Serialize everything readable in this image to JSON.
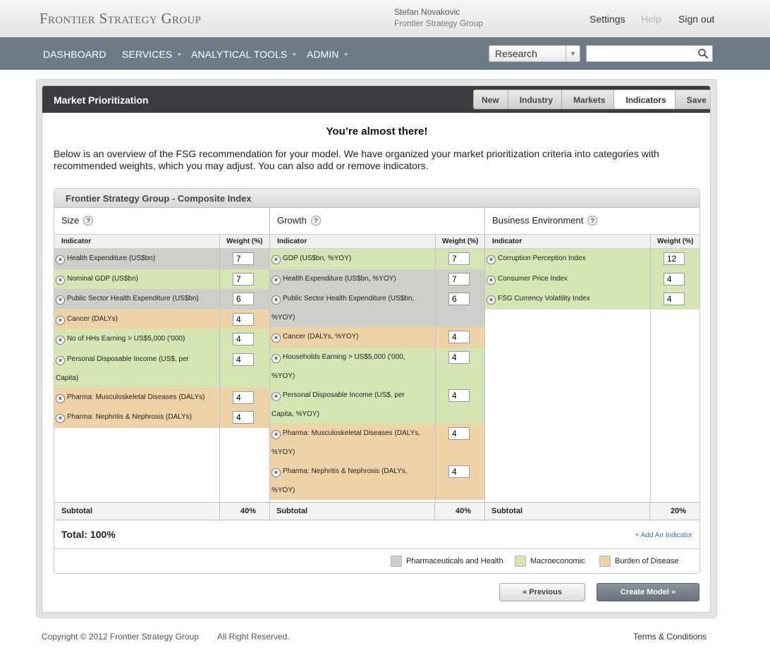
{
  "brand": {
    "logo": "Frontier Strategy Group"
  },
  "user": {
    "name": "Stefan Novakovic",
    "org": "Frontier Strategy Group"
  },
  "toplinks": {
    "settings": "Settings",
    "help": "Help",
    "signout": "Sign out"
  },
  "nav": {
    "dashboard": "DASHBOARD",
    "services": "SERVICES",
    "tools": "ANALYTICAL TOOLS",
    "admin": "ADMIN",
    "research_select": "Research",
    "search_placeholder": ""
  },
  "page": {
    "title": "Market Prioritization",
    "steps": [
      "New",
      "Industry",
      "Markets",
      "Indicators",
      "Save"
    ],
    "active_step": "Indicators",
    "heading": "You’re almost there!",
    "intro": "Below is an overview of the FSG recommendation for your model. We have organized your market prioritization criteria into categories with recommended weights, which you may adjust. You can also add or remove indicators."
  },
  "panel": {
    "title": "Frontier Strategy Group - Composite Index",
    "indicator_header": "Indicator",
    "weight_header": "Weight (%)",
    "subtotal_label": "Subtotal",
    "total": "Total: 100%",
    "add_indicator": "+ Add An Indicator",
    "columns": [
      {
        "title": "Size",
        "subtotal": "40%",
        "rows": [
          {
            "label": "Health Expenditure (US$bn)",
            "weight": "7",
            "category": "pharma"
          },
          {
            "label": "Nominal GDP (US$bn)",
            "weight": "7",
            "category": "macro"
          },
          {
            "label": "Public Sector Health Expenditure (US$bn)",
            "weight": "6",
            "category": "pharma"
          },
          {
            "label": "Cancer (DALYs)",
            "weight": "4",
            "category": "burden"
          },
          {
            "label": "No of HHs Earning > US$5,000 ('000)",
            "weight": "4",
            "category": "macro"
          },
          {
            "label": "Personal Disposable Income (US$, per",
            "label2": "Capita)",
            "weight": "4",
            "category": "macro"
          },
          {
            "label": "Pharma: Musculoskeletal Diseases (DALYs)",
            "weight": "4",
            "category": "burden"
          },
          {
            "label": "Pharma: Nephritis & Nephrosis (DALYs)",
            "weight": "4",
            "category": "burden"
          }
        ]
      },
      {
        "title": "Growth",
        "subtotal": "40%",
        "rows": [
          {
            "label": "GDP (US$bn, %YOY)",
            "weight": "7",
            "category": "macro"
          },
          {
            "label": "Health Expenditure (US$bn, %YOY)",
            "weight": "7",
            "category": "pharma"
          },
          {
            "label": "Public Sector Health Expenditure (US$bn,",
            "label2": "%YOY)",
            "weight": "6",
            "category": "pharma"
          },
          {
            "label": "Cancer (DALYs, %YOY)",
            "weight": "4",
            "category": "burden"
          },
          {
            "label": "Households Earning > US$5,000 ('000,",
            "label2": "%YOY)",
            "weight": "4",
            "category": "macro"
          },
          {
            "label": "Personal Disposable Income (US$, per",
            "label2": "Capita, %YOY)",
            "weight": "4",
            "category": "macro"
          },
          {
            "label": "Pharma: Musculoskeletal Diseases (DALYs,",
            "label2": "%YOY)",
            "weight": "4",
            "category": "burden"
          },
          {
            "label": "Pharma: Nephritis & Nephrosis (DALYs,",
            "label2": "%YOY)",
            "weight": "4",
            "category": "burden"
          }
        ]
      },
      {
        "title": "Business Environment",
        "subtotal": "20%",
        "rows": [
          {
            "label": "Corruption Perception Index",
            "weight": "12",
            "category": "macro"
          },
          {
            "label": "Consumer Price Index",
            "weight": "4",
            "category": "macro"
          },
          {
            "label": "FSG Currency Volatility Index",
            "weight": "4",
            "category": "macro"
          }
        ]
      }
    ],
    "legend": [
      {
        "label": "Pharmaceuticals and Health",
        "color": "#cfcfc9"
      },
      {
        "label": "Macroeconomic",
        "color": "#d6e5b4"
      },
      {
        "label": "Burden of Disease",
        "color": "#efd3a8"
      }
    ]
  },
  "buttons": {
    "previous": "« Previous",
    "create": "Create Model »"
  },
  "footer": {
    "copyright": "Copyright © 2012 Frontier Strategy Group",
    "rights": "All Right Reserved.",
    "terms": "Terms & Conditions"
  }
}
